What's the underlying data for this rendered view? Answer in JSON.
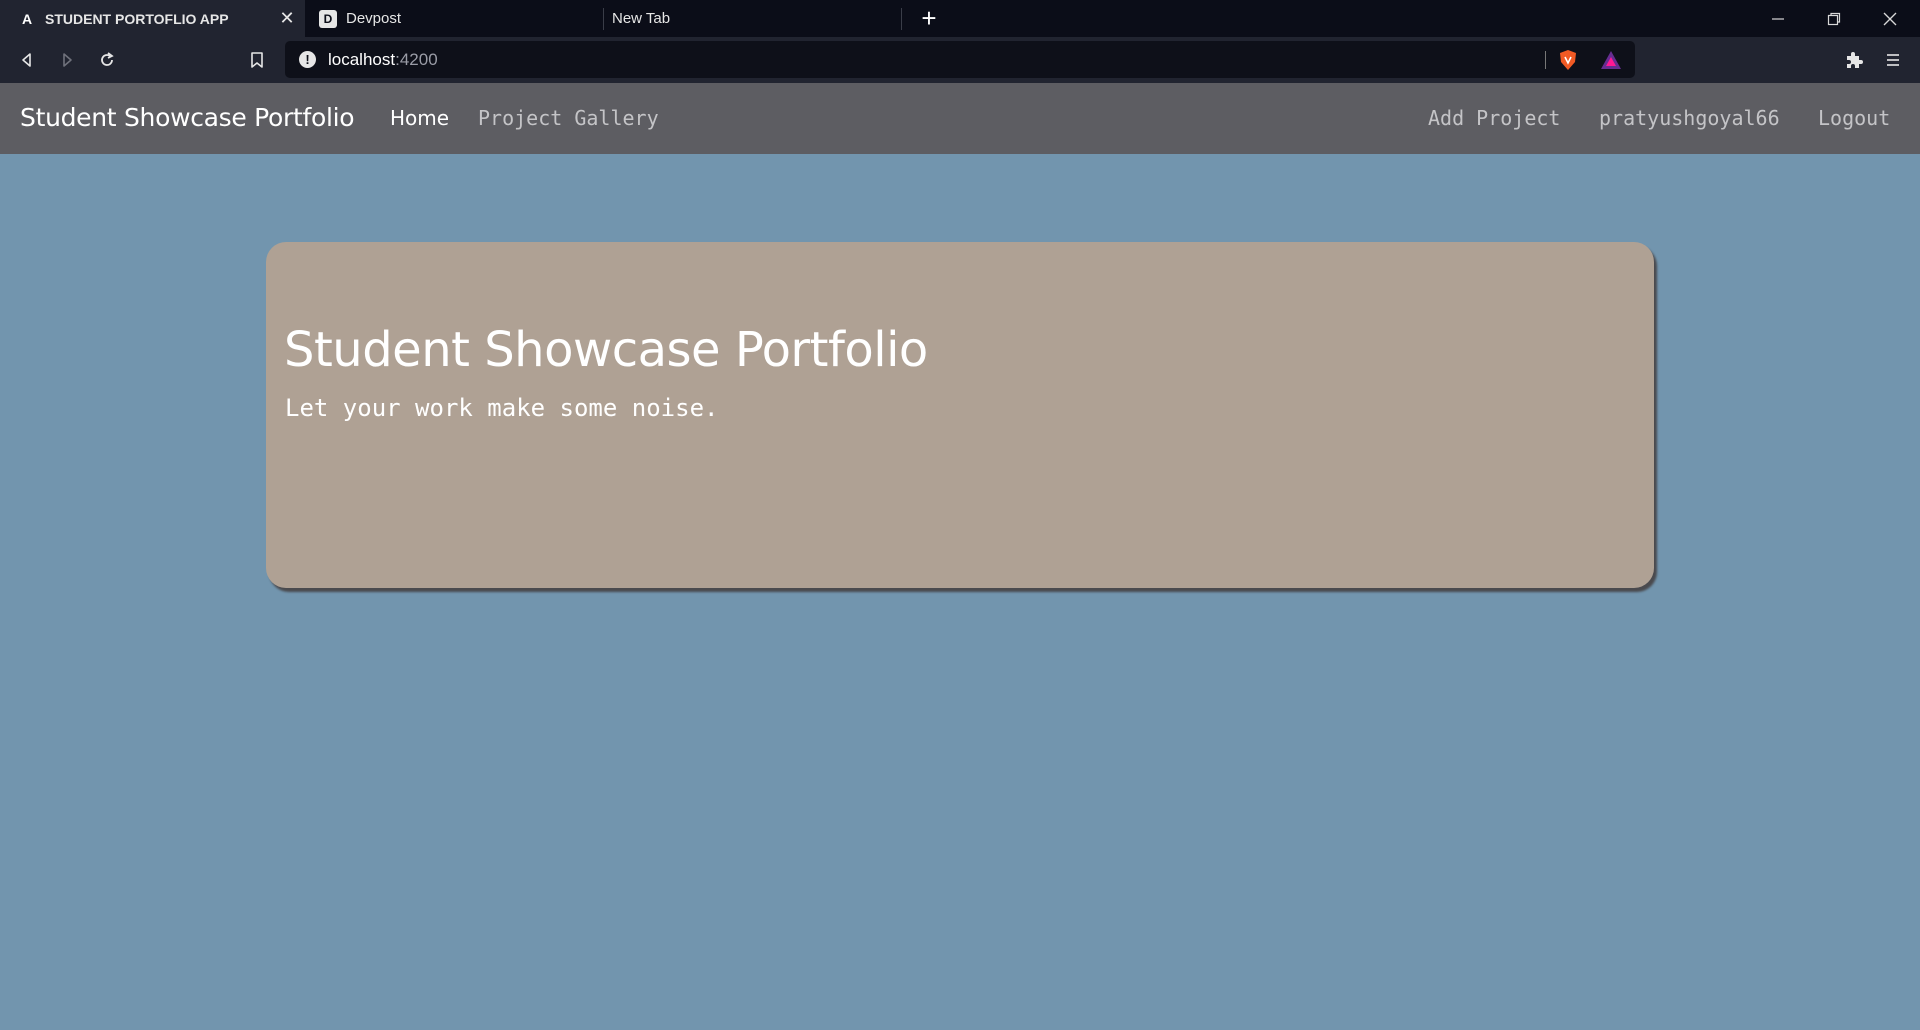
{
  "browser": {
    "tabs": [
      {
        "favicon": "A",
        "title": "STUDENT PORTOFLIO APP",
        "active": true
      },
      {
        "favicon": "D",
        "title": "Devpost",
        "active": false
      },
      {
        "favicon": "",
        "title": "New Tab",
        "active": false
      }
    ],
    "new_tab": "+",
    "url": {
      "host": "localhost",
      "port": ":4200"
    }
  },
  "navbar": {
    "brand": "Student Showcase Portfolio",
    "links_left": [
      {
        "label": "Home",
        "active": true
      },
      {
        "label": "Project Gallery",
        "active": false
      }
    ],
    "links_right": [
      {
        "label": "Add Project"
      },
      {
        "label": "pratyushgoyal66"
      },
      {
        "label": "Logout"
      }
    ]
  },
  "hero": {
    "title": "Student Showcase Portfolio",
    "subtitle": "Let your work make some noise."
  },
  "colors": {
    "page_bg": "#7295ae",
    "navbar_bg": "#5d5d62",
    "card_bg": "#afa194"
  }
}
